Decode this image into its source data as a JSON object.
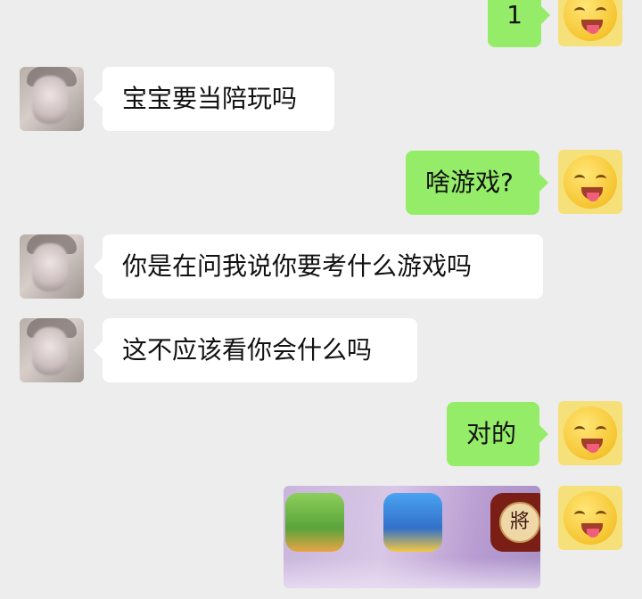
{
  "messages": [
    {
      "side": "right",
      "text": "1"
    },
    {
      "side": "left",
      "text": "宝宝要当陪玩吗"
    },
    {
      "side": "right",
      "text": "啥游戏?"
    },
    {
      "side": "left",
      "text": "你是在问我说你要考什么游戏吗"
    },
    {
      "side": "left",
      "text": "这不应该看你会什么吗"
    },
    {
      "side": "right",
      "text": "对的"
    }
  ],
  "image_message": {
    "apps": [
      {
        "icon": "mini-world-app-icon"
      },
      {
        "icon": "cartoon-game-app-icon"
      },
      {
        "icon": "chinese-chess-app-icon",
        "glyph": "將"
      }
    ]
  },
  "colors": {
    "background": "#ededed",
    "sent_bubble": "#95ec69",
    "received_bubble": "#ffffff"
  }
}
